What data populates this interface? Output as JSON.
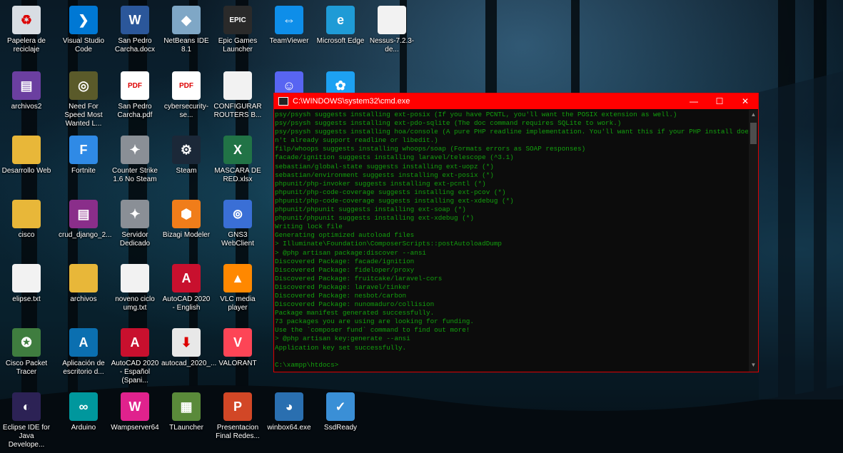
{
  "desktop": {
    "icons": [
      {
        "label": "Papelera de reciclaje",
        "icon": "recycle-bin-icon",
        "color": "#d8dde3",
        "glyph": "♻"
      },
      {
        "label": "Visual Studio Code",
        "icon": "vscode-icon",
        "color": "#0078d4",
        "glyph": "❯"
      },
      {
        "label": "San Pedro Carcha.docx",
        "icon": "word-icon",
        "color": "#2b579a",
        "glyph": "W"
      },
      {
        "label": "NetBeans IDE 8.1",
        "icon": "netbeans-icon",
        "color": "#7fa7c6",
        "glyph": "◆"
      },
      {
        "label": "Epic Games Launcher",
        "icon": "epic-games-icon",
        "color": "#2a2a2a",
        "glyph": "EPIC"
      },
      {
        "label": "TeamViewer",
        "icon": "teamviewer-icon",
        "color": "#0e8ee9",
        "glyph": "⇔"
      },
      {
        "label": "Microsoft Edge",
        "icon": "edge-icon",
        "color": "#1f9bd6",
        "glyph": "e"
      },
      {
        "label": "Nessus-7.2.3-de...",
        "icon": "file-icon",
        "color": "#f2f2f2",
        "glyph": ""
      },
      {
        "label": "archivos2",
        "icon": "winrar-icon",
        "color": "#6b3fa0",
        "glyph": "▤"
      },
      {
        "label": "Need For Speed Most Wanted L...",
        "icon": "nfs-icon",
        "color": "#5a5a2a",
        "glyph": "◎"
      },
      {
        "label": "San Pedro Carcha.pdf",
        "icon": "pdf-icon",
        "color": "#ffffff",
        "glyph": "PDF"
      },
      {
        "label": "cybersecurity-se...",
        "icon": "pdf-icon",
        "color": "#ffffff",
        "glyph": "PDF"
      },
      {
        "label": "CONFIGURAR ROUTERS B...",
        "icon": "file-icon",
        "color": "#f2f2f2",
        "glyph": ""
      },
      {
        "label": "Desarrollo Web",
        "icon": "folder-icon",
        "color": "#e8b739",
        "glyph": ""
      },
      {
        "label": "Fortnite",
        "icon": "fortnite-icon",
        "color": "#2f8ae6",
        "glyph": "F"
      },
      {
        "label": "Counter Strike 1.6 No Steam",
        "icon": "counter-strike-icon",
        "color": "#8a8f96",
        "glyph": "✦"
      },
      {
        "label": "Steam",
        "icon": "steam-icon",
        "color": "#1b2838",
        "glyph": "⚙"
      },
      {
        "label": "MASCARA DE RED.xlsx",
        "icon": "excel-icon",
        "color": "#217346",
        "glyph": "X"
      },
      {
        "label": "cisco",
        "icon": "folder-icon",
        "color": "#e8b739",
        "glyph": ""
      },
      {
        "label": "crud_django_2...",
        "icon": "winrar-icon",
        "color": "#8a2e8a",
        "glyph": "▤"
      },
      {
        "label": "Servidor Dedicado",
        "icon": "counter-strike-icon",
        "color": "#8a8f96",
        "glyph": "✦"
      },
      {
        "label": "Bizagi Modeler",
        "icon": "bizagi-icon",
        "color": "#f07d1a",
        "glyph": "⬢"
      },
      {
        "label": "GNS3 WebClient",
        "icon": "gns3-icon",
        "color": "#3a6fd6",
        "glyph": "⊚"
      },
      {
        "label": "elipse.txt",
        "icon": "text-file-icon",
        "color": "#f2f2f2",
        "glyph": ""
      },
      {
        "label": "archivos",
        "icon": "folder-icon",
        "color": "#e8b739",
        "glyph": ""
      },
      {
        "label": "noveno ciclo umg.txt",
        "icon": "text-file-icon",
        "color": "#f2f2f2",
        "glyph": ""
      },
      {
        "label": "AutoCAD 2020 - English",
        "icon": "autocad-icon",
        "color": "#c8102e",
        "glyph": "A"
      },
      {
        "label": "VLC media player",
        "icon": "vlc-icon",
        "color": "#ff8800",
        "glyph": "▲"
      },
      {
        "label": "Cisco Packet Tracer",
        "icon": "packet-tracer-icon",
        "color": "#3f7d3f",
        "glyph": "✪"
      },
      {
        "label": "Aplicación de escritorio d...",
        "icon": "autodesk-icon",
        "color": "#0b6fb0",
        "glyph": "A"
      },
      {
        "label": "AutoCAD 2020 - Español (Spani...",
        "icon": "autocad-icon",
        "color": "#c8102e",
        "glyph": "A"
      },
      {
        "label": "autocad_2020_...",
        "icon": "download-icon",
        "color": "#e8e8e8",
        "glyph": "⬇"
      },
      {
        "label": "VALORANT",
        "icon": "valorant-icon",
        "color": "#fd4556",
        "glyph": "V"
      },
      {
        "label": "Eclipse IDE for Java Develope...",
        "icon": "eclipse-icon",
        "color": "#2c2255",
        "glyph": "◐"
      },
      {
        "label": "Arduino",
        "icon": "arduino-icon",
        "color": "#00979d",
        "glyph": "∞"
      },
      {
        "label": "Wampserver64",
        "icon": "wampserver-icon",
        "color": "#e0228d",
        "glyph": "W"
      },
      {
        "label": "TLauncher",
        "icon": "minecraft-icon",
        "color": "#5a8a3a",
        "glyph": "▦"
      },
      {
        "label": "Presentacion Final Redes...",
        "icon": "powerpoint-icon",
        "color": "#d24726",
        "glyph": "P"
      },
      {
        "label": "winbox64.exe",
        "icon": "winbox-icon",
        "color": "#2a6fb0",
        "glyph": "◕"
      },
      {
        "label": "SsdReady",
        "icon": "ssdready-icon",
        "color": "#3a8fd6",
        "glyph": "✓"
      },
      {
        "label": "",
        "icon": "discord-icon",
        "color": "#5865f2",
        "glyph": "☺"
      },
      {
        "label": "",
        "icon": "twitter-icon",
        "color": "#1da1f2",
        "glyph": "✿"
      }
    ]
  },
  "cmd": {
    "title": "C:\\WINDOWS\\system32\\cmd.exe",
    "lines": [
      "psy/psysh suggests installing ext-posix (If you have PCNTL, you'll want the POSIX extension as well.)",
      "psy/psysh suggests installing ext-pdo-sqlite (The doc command requires SQLite to work.)",
      "psy/psysh suggests installing hoa/console (A pure PHP readline implementation. You'll want this if your PHP install does",
      "n't already support readline or libedit.)",
      "filp/whoops suggests installing whoops/soap (Formats errors as SOAP responses)",
      "facade/ignition suggests installing laravel/telescope (^3.1)",
      "sebastian/global-state suggests installing ext-uopz (*)",
      "sebastian/environment suggests installing ext-posix (*)",
      "phpunit/php-invoker suggests installing ext-pcntl (*)",
      "phpunit/php-code-coverage suggests installing ext-pcov (*)",
      "phpunit/php-code-coverage suggests installing ext-xdebug (*)",
      "phpunit/phpunit suggests installing ext-soap (*)",
      "phpunit/phpunit suggests installing ext-xdebug (*)",
      "Writing lock file",
      "Generating optimized autoload files",
      "> Illuminate\\Foundation\\ComposerScripts::postAutoloadDump",
      "> @php artisan package:discover --ansi",
      "Discovered Package: facade/ignition",
      "Discovered Package: fideloper/proxy",
      "Discovered Package: fruitcake/laravel-cors",
      "Discovered Package: laravel/tinker",
      "Discovered Package: nesbot/carbon",
      "Discovered Package: nunomaduro/collision",
      "Package manifest generated successfully.",
      "73 packages you are using are looking for funding.",
      "Use the `composer fund` command to find out more!",
      "> @php artisan key:generate --ansi",
      "Application key set successfully.",
      "",
      "C:\\xampp\\htdocs>"
    ],
    "minimize": "—",
    "maximize": "☐",
    "close": "✕"
  }
}
